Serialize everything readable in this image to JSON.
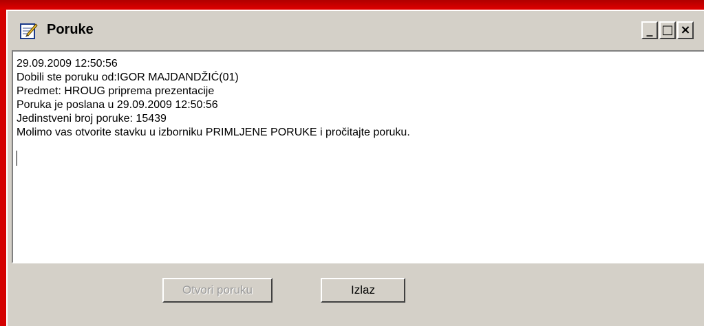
{
  "window": {
    "title": "Poruke",
    "title_icon": "notepad-edit-icon",
    "controls": {
      "minimize": "_",
      "maximize": "□",
      "close": "×"
    }
  },
  "message": {
    "lines": [
      "29.09.2009 12:50:56",
      "Dobili ste poruku od:IGOR MAJDANDŽIĆ(01)",
      "Predmet: HROUG priprema prezentacije",
      "Poruka je poslana u 29.09.2009 12:50:56",
      "Jedinstveni broj poruke: 15439",
      "Molimo vas otvorite stavku u izborniku PRIMLJENE PORUKE i pročitajte poruku."
    ]
  },
  "buttons": {
    "open_label": "Otvori poruku",
    "open_enabled": false,
    "exit_label": "Izlaz"
  },
  "colors": {
    "desktop": "#d40000",
    "window_face": "#d4d0c8",
    "disabled_text": "#9a9a9a"
  }
}
